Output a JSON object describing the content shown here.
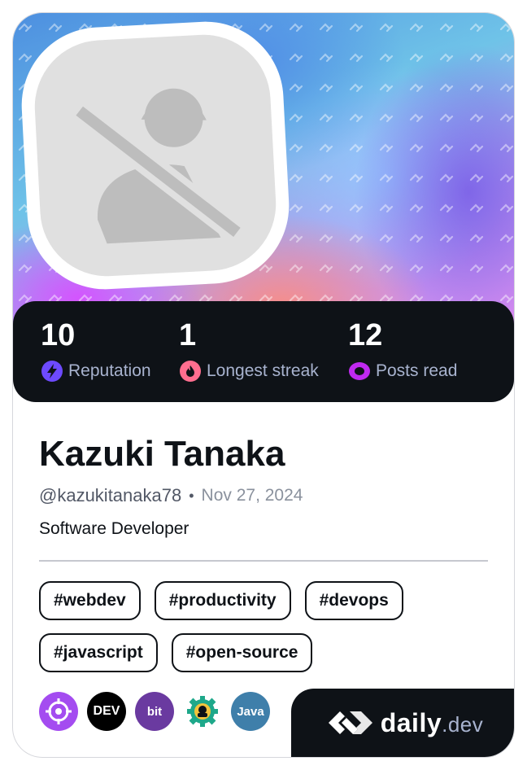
{
  "profile": {
    "name": "Kazuki Tanaka",
    "handle": "@kazukitanaka78",
    "joined": "Nov 27, 2024",
    "bio": "Software Developer"
  },
  "stats": [
    {
      "value": "10",
      "label": "Reputation",
      "icon": "lightning-icon",
      "color": "#6d4afe"
    },
    {
      "value": "1",
      "label": "Longest streak",
      "icon": "flame-icon",
      "color": "#ff6e8f"
    },
    {
      "value": "12",
      "label": "Posts read",
      "icon": "eye-icon",
      "color": "#c029f0"
    }
  ],
  "tags": [
    "#webdev",
    "#productivity",
    "#devops",
    "#javascript",
    "#open-source"
  ],
  "sources": [
    {
      "name": "crosshair-source-icon",
      "color": "#a44cf0"
    },
    {
      "name": "dev-source-icon",
      "label": "DEV",
      "color": "#000000"
    },
    {
      "name": "bit-source-icon",
      "label": "bit",
      "color": "#6a3aa0"
    },
    {
      "name": "gear-source-icon",
      "color": "#1ea88a"
    },
    {
      "name": "java-source-icon",
      "label": "Java",
      "color": "#3f7faa"
    }
  ],
  "brand": {
    "word": "daily",
    "tld": ".dev"
  },
  "colors": {
    "dark": "#0e1217",
    "muted": "#a8b3cf"
  }
}
